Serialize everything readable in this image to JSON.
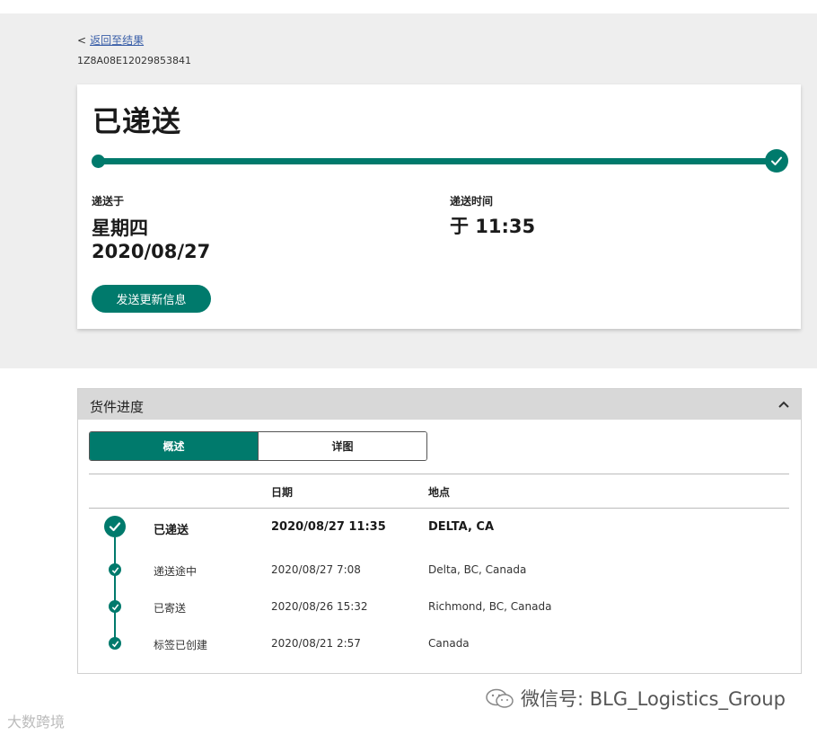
{
  "back": {
    "chevron": "<",
    "label": "返回至结果"
  },
  "tracking_number": "1Z8A08E12029853841",
  "status": {
    "title": "已递送",
    "progress_fraction": 1.0,
    "delivered_on_label": "递送于",
    "delivered_day": "星期四",
    "delivered_date": "2020/08/27",
    "delivery_time_label": "递送时间",
    "delivery_time": "于 11:35",
    "update_button": "发送更新信息"
  },
  "panel": {
    "title": "货件进度",
    "tabs": [
      {
        "label": "概述",
        "active": true
      },
      {
        "label": "详图",
        "active": false
      }
    ],
    "columns": {
      "date": "日期",
      "location": "地点"
    },
    "events": [
      {
        "status": "已递送",
        "date": "2020/08/27  11:35",
        "location": "DELTA, CA"
      },
      {
        "status": "递送途中",
        "date": "2020/08/27  7:08",
        "location": "Delta, BC, Canada"
      },
      {
        "status": "已寄送",
        "date": "2020/08/26  15:32",
        "location": "Richmond, BC, Canada"
      },
      {
        "status": "标签已创建",
        "date": "2020/08/21  2:57",
        "location": "Canada"
      }
    ]
  },
  "watermark": {
    "text": "微信号: BLG_Logistics_Group",
    "corner": "大数跨境"
  },
  "colors": {
    "accent": "#007a6c",
    "band": "#eeeeee",
    "header": "#d8d8d8"
  },
  "icons": [
    "check-icon",
    "chevron-up-icon",
    "wechat-icon"
  ]
}
